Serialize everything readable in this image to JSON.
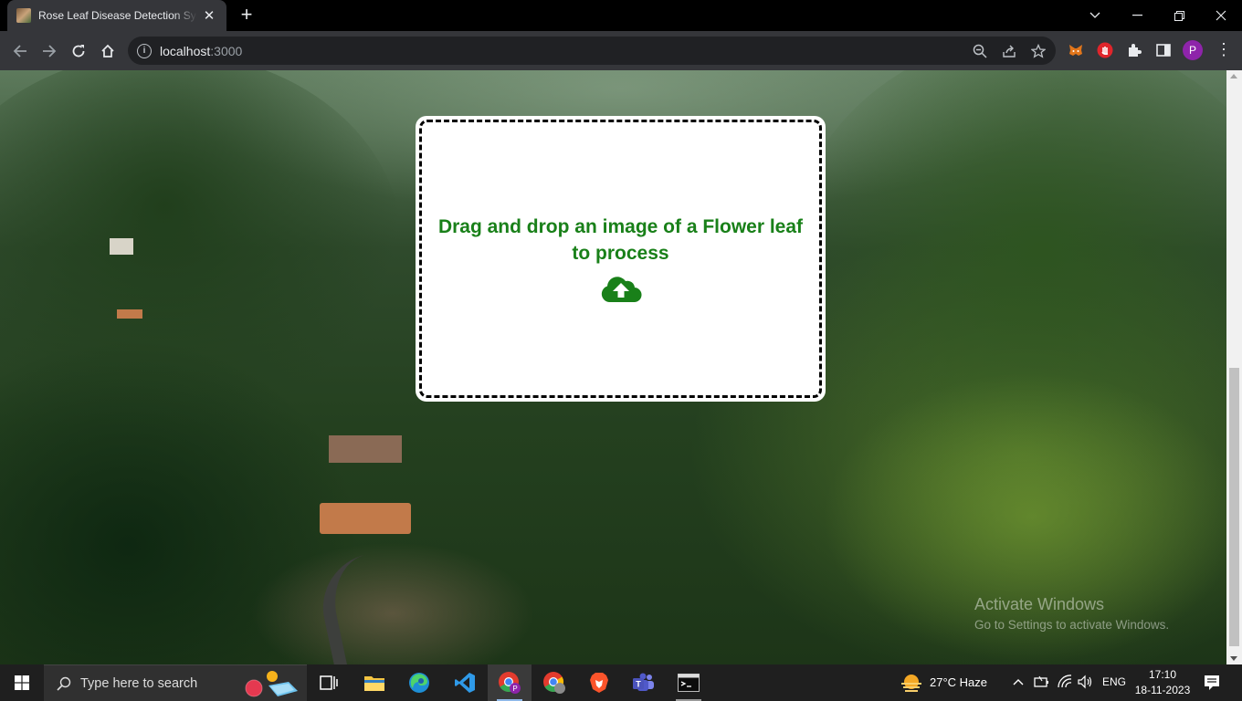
{
  "browser": {
    "tab_title": "Rose Leaf Disease Detection System",
    "new_tab_label": "+",
    "url_host": "localhost",
    "url_port": ":3000",
    "profile_initial": "P",
    "accent": "#35363a"
  },
  "page": {
    "dropzone_text": "Drag and drop an image of a Flower leaf to process",
    "text_color": "#198019",
    "icon": "cloud-upload-icon"
  },
  "watermark": {
    "line1": "Activate Windows",
    "line2": "Go to Settings to activate Windows."
  },
  "taskbar": {
    "search_placeholder": "Type here to search",
    "apps": [
      "task-view",
      "file-explorer",
      "edge",
      "vscode",
      "chrome-profile-p",
      "chrome",
      "brave",
      "teams",
      "terminal"
    ],
    "weather": "27°C  Haze",
    "language": "ENG",
    "time": "17:10",
    "date": "18-11-2023"
  }
}
